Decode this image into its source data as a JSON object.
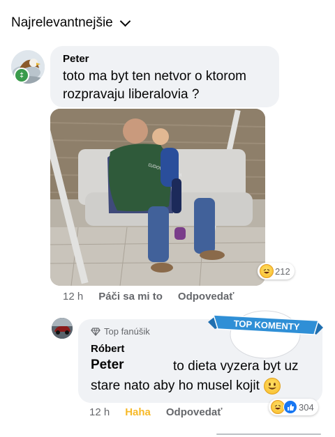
{
  "header": {
    "sort_label": "Najrelevantnejšie",
    "sort_icon": "chevron-down-icon"
  },
  "comment": {
    "author": "Peter",
    "text": "toto ma byt ten netvor o ktorom rozpravaju liberalovia ?",
    "reactions": {
      "icon": "haha-reaction-icon",
      "count": "212"
    },
    "time": "12 h",
    "like_label": "Páči sa mi to",
    "reply_label": "Odpovedať"
  },
  "reply": {
    "badge_icon": "diamond-icon",
    "badge_label": "Top fanúšik",
    "author": "Róbert",
    "tagged_name": "Peter",
    "text_line1": "to dieta vyzera byt uz",
    "text_line2": "stare nato aby ho musel kojit",
    "reactions": {
      "icons": [
        "haha-reaction-icon",
        "like-reaction-icon"
      ],
      "count": "304"
    },
    "time": "12 h",
    "reaction_label": "Haha",
    "reply_label": "Odpovedať"
  },
  "overlay": {
    "label": "TOP KOMENTY"
  },
  "colors": {
    "bubble": "#f0f2f5",
    "meta_text": "#65676b",
    "haha_active": "#f7b928",
    "banner": "#2f8fd6",
    "like_blue": "#1877f2"
  }
}
